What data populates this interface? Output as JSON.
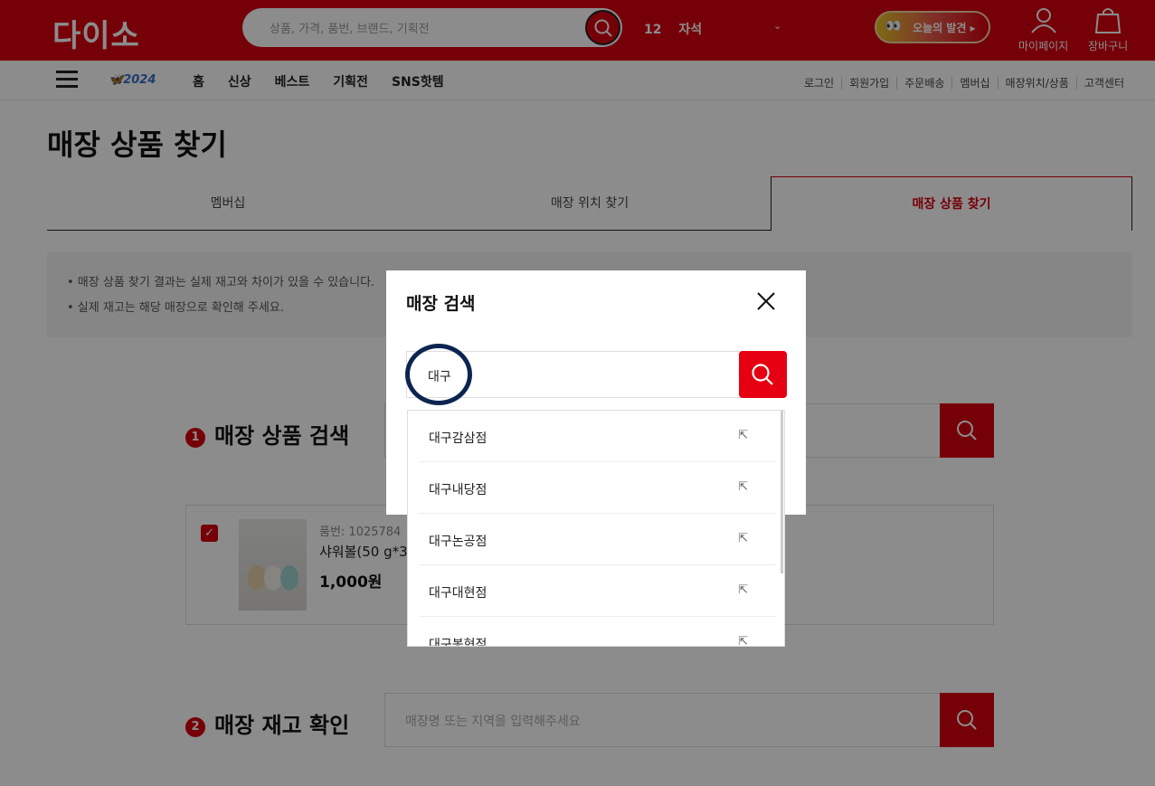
{
  "header": {
    "logo": "다이소",
    "search_placeholder": "상품, 가격, 품번, 브랜드, 기획전",
    "rank_number": "12",
    "rank_keyword": "자석",
    "today_label": "오늘의 발견 ▸",
    "mypage_label": "마이페이지",
    "cart_label": "장바구니"
  },
  "nav": {
    "badge": "2024",
    "menu": [
      "홈",
      "신상",
      "베스트",
      "기획전",
      "SNS핫템"
    ],
    "util": [
      "로그인",
      "회원가입",
      "주문배송",
      "멤버십",
      "매장위치/상품",
      "고객센터"
    ]
  },
  "page": {
    "title": "매장 상품 찾기",
    "tabs": [
      "멤버십",
      "매장 위치 찾기",
      "매장 상품 찾기"
    ],
    "notices": [
      "• 매장 상품 찾기 결과는 실제 재고와 차이가 있을 수 있습니다.",
      "• 실제 재고는 해당 매장으로 확인해 주세요."
    ],
    "section1": {
      "num": "1",
      "title": "매장 상품 검색"
    },
    "section2": {
      "num": "2",
      "title": "매장 재고 확인",
      "placeholder": "매장명 또는 지역을 입력해주세요"
    },
    "product": {
      "code": "품번: 1025784",
      "name": "샤워볼(50 g*3",
      "price": "1,000원"
    }
  },
  "modal": {
    "title": "매장 검색",
    "input_value": "대구",
    "suggestions": [
      "대구감삼점",
      "대구내당점",
      "대구논공점",
      "대구대현점",
      "대구봉현점"
    ],
    "arrow": "⇱"
  }
}
